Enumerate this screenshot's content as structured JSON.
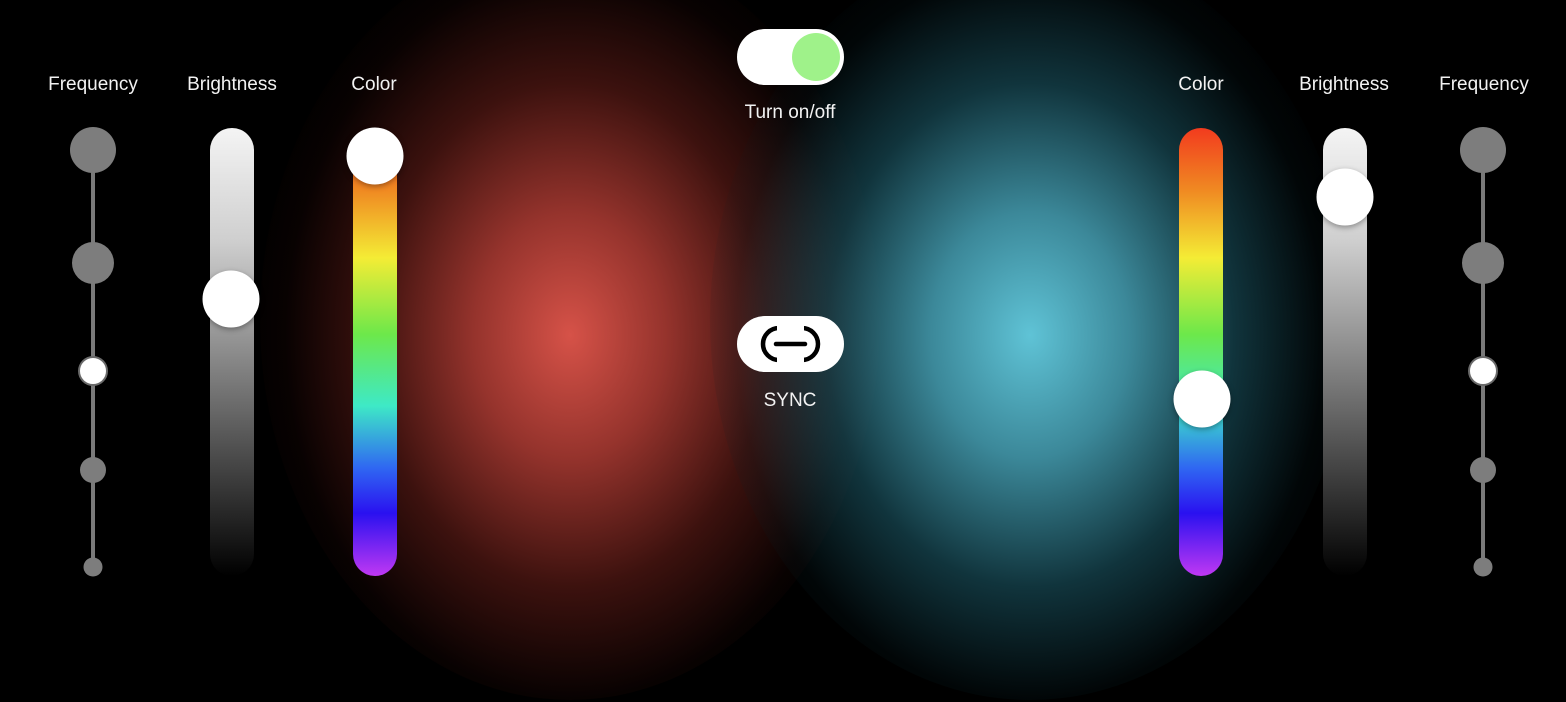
{
  "power": {
    "label": "Turn on/off",
    "state": "on",
    "accent_color": "#9ff28a"
  },
  "sync": {
    "label": "SYNC",
    "icon": "link-icon"
  },
  "left_light": {
    "glow_color": "#d65248",
    "frequency": {
      "label": "Frequency",
      "steps": 5,
      "selected_step": 3
    },
    "brightness": {
      "label": "Brightness",
      "value": 0.4
    },
    "color": {
      "label": "Color",
      "value": 0.06
    }
  },
  "right_light": {
    "glow_color": "#5fc3d6",
    "color": {
      "label": "Color",
      "value": 0.6
    },
    "brightness": {
      "label": "Brightness",
      "value": 0.15
    },
    "frequency": {
      "label": "Frequency",
      "steps": 5,
      "selected_step": 3
    }
  }
}
